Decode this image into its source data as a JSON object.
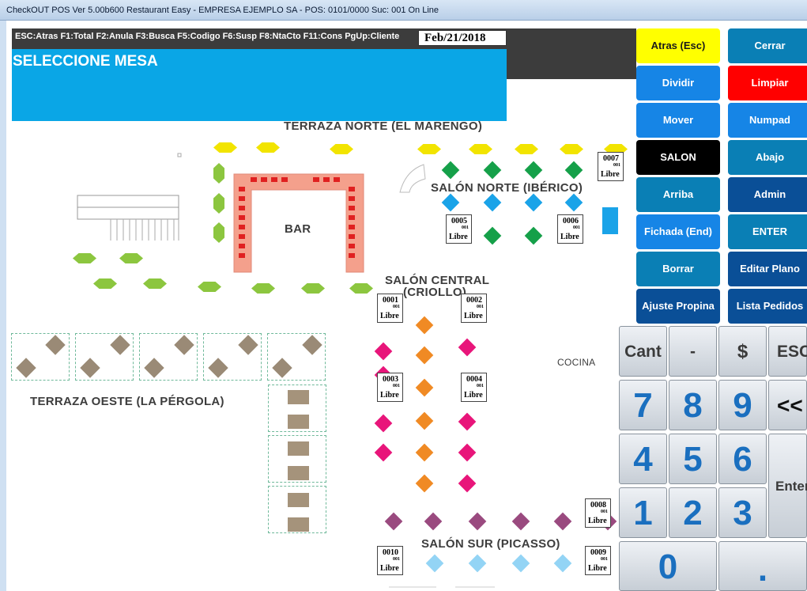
{
  "window": {
    "title": "CheckOUT POS Ver 5.00b600 Restaurant Easy - EMPRESA EJEMPLO SA - POS: 0101/0000 Suc: 001  On Line"
  },
  "header": {
    "shortcuts": "ESC:Atras F1:Total F2:Anula F3:Busca F5:Codigo F6:Susp F8:NtaCto F11:Cons PgUp:Cliente",
    "date": "Feb/21/2018",
    "prompt": "SELECCIONE MESA"
  },
  "zones": {
    "terraza_norte": "TERRAZA NORTE (EL MARENGO)",
    "salon_norte": "SALÓN NORTE (IBÉRICO)",
    "bar": "BAR",
    "salon_central": "SALÓN CENTRAL",
    "salon_central_sub": "(CRIOLLO)",
    "terraza_oeste": "TERRAZA OESTE (LA PÉRGOLA)",
    "cocina": "COCINA",
    "salon_sur": "SALÓN SUR (PICASSO)"
  },
  "tables": [
    {
      "number": "0007",
      "branch": "001",
      "status": "Libre"
    },
    {
      "number": "0005",
      "branch": "001",
      "status": "Libre"
    },
    {
      "number": "0006",
      "branch": "001",
      "status": "Libre"
    },
    {
      "number": "0001",
      "branch": "001",
      "status": "Libre"
    },
    {
      "number": "0002",
      "branch": "001",
      "status": "Libre"
    },
    {
      "number": "0003",
      "branch": "001",
      "status": "Libre"
    },
    {
      "number": "0004",
      "branch": "001",
      "status": "Libre"
    },
    {
      "number": "0008",
      "branch": "001",
      "status": "Libre"
    },
    {
      "number": "0010",
      "branch": "001",
      "status": "Libre"
    },
    {
      "number": "0009",
      "branch": "001",
      "status": "Libre"
    }
  ],
  "buttons": [
    {
      "label": "Atras (Esc)",
      "bg": "#ffff00",
      "fg": "#1a1a1a"
    },
    {
      "label": "Cerrar",
      "bg": "#0a7fb5",
      "fg": "#ffffff"
    },
    {
      "label": "Dividir",
      "bg": "#1685e6",
      "fg": "#ffffff"
    },
    {
      "label": "Limpiar",
      "bg": "#ff0000",
      "fg": "#ffffff"
    },
    {
      "label": "Mover",
      "bg": "#1685e6",
      "fg": "#ffffff"
    },
    {
      "label": "Numpad",
      "bg": "#1685e6",
      "fg": "#ffffff"
    },
    {
      "label": "SALON",
      "bg": "#000000",
      "fg": "#ffffff"
    },
    {
      "label": "Abajo",
      "bg": "#0a7fb5",
      "fg": "#ffffff"
    },
    {
      "label": "Arriba",
      "bg": "#0a7fb5",
      "fg": "#ffffff"
    },
    {
      "label": "Admin",
      "bg": "#0a4f97",
      "fg": "#ffffff"
    },
    {
      "label": "Fichada (End)",
      "bg": "#1685e6",
      "fg": "#ffffff"
    },
    {
      "label": "ENTER",
      "bg": "#0a7fb5",
      "fg": "#ffffff"
    },
    {
      "label": "Borrar",
      "bg": "#0a7fb5",
      "fg": "#ffffff"
    },
    {
      "label": "Editar Plano",
      "bg": "#0a4f97",
      "fg": "#ffffff"
    },
    {
      "label": "Ajuste Propina",
      "bg": "#0a4f97",
      "fg": "#ffffff"
    },
    {
      "label": "Lista Pedidos",
      "bg": "#0a4f97",
      "fg": "#ffffff"
    }
  ],
  "keypad": {
    "cant": "Cant",
    "minus": "-",
    "dollar": "$",
    "esc": "ESC",
    "k7": "7",
    "k8": "8",
    "k9": "9",
    "back": "<<",
    "k4": "4",
    "k5": "5",
    "k6": "6",
    "enter": "Enter",
    "k1": "1",
    "k2": "2",
    "k3": "3",
    "k0": "0",
    "dot": "."
  },
  "colors": {
    "yellow_seat": "#f2e400",
    "green_seat": "#8cc63f",
    "teal_table": "#15a049",
    "blue_table": "#1aa3e8",
    "orange_table": "#f08a24",
    "pink_table": "#e8157a",
    "purple_table": "#9a4a7f",
    "light_blue_table": "#93d4f5",
    "bar": "#f4a08c"
  }
}
